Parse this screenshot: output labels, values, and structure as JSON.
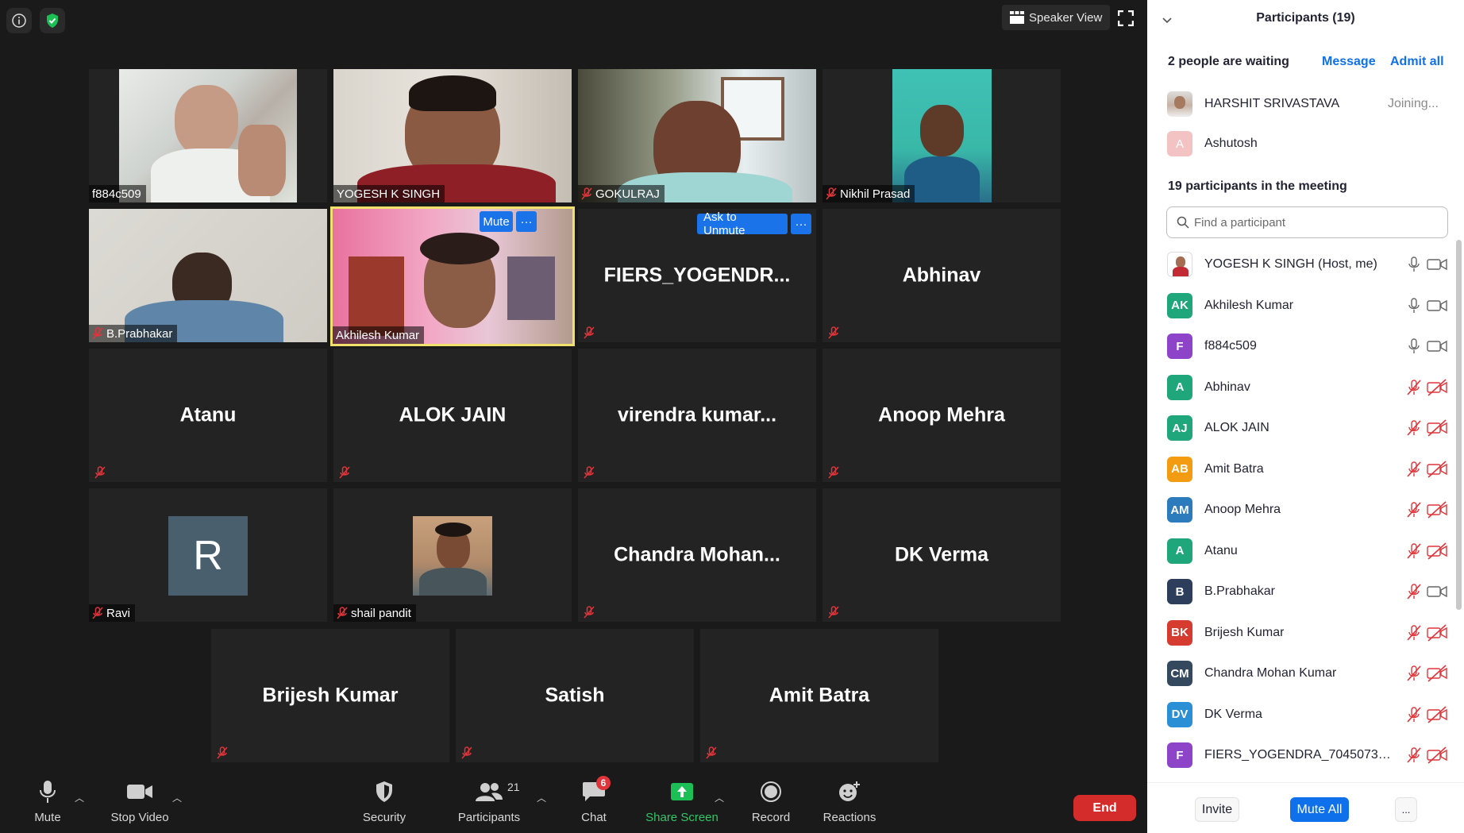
{
  "meeting": {
    "top_bar": {
      "speaker_view_label": "Speaker View"
    },
    "tiles": [
      {
        "name": "f884c509",
        "kind": "video",
        "muted": false
      },
      {
        "name": "YOGESH K SINGH",
        "kind": "video",
        "muted": false
      },
      {
        "name": "GOKULRAJ",
        "kind": "video",
        "muted": true
      },
      {
        "name": "Nikhil Prasad",
        "kind": "video",
        "muted": true
      },
      {
        "name": "B.Prabhakar",
        "kind": "video",
        "muted": true
      },
      {
        "name": "Akhilesh Kumar",
        "kind": "video",
        "muted": false,
        "active_speaker": true,
        "hover_button": "Mute"
      },
      {
        "name": "FIERS_YOGENDR...",
        "kind": "name",
        "muted": true,
        "hover_button": "Ask to Unmute"
      },
      {
        "name": "Abhinav",
        "kind": "name",
        "muted": true
      },
      {
        "name": "Atanu",
        "kind": "name",
        "muted": true
      },
      {
        "name": "ALOK JAIN",
        "kind": "name",
        "muted": true
      },
      {
        "name": "virendra  kumar...",
        "kind": "name",
        "muted": true
      },
      {
        "name": "Anoop Mehra",
        "kind": "name",
        "muted": true
      },
      {
        "name": "Ravi",
        "kind": "avatar",
        "avatar_letter": "R",
        "muted": true
      },
      {
        "name": "shail pandit",
        "kind": "photo",
        "muted": true
      },
      {
        "name": "Chandra  Mohan...",
        "kind": "name",
        "muted": true
      },
      {
        "name": "DK Verma",
        "kind": "name",
        "muted": true
      },
      {
        "name": "Brijesh Kumar",
        "kind": "name",
        "muted": true
      },
      {
        "name": "Satish",
        "kind": "name",
        "muted": true
      },
      {
        "name": "Amit Batra",
        "kind": "name",
        "muted": true
      }
    ],
    "more_label": "···"
  },
  "toolbar": {
    "mute_label": "Mute",
    "stop_video_label": "Stop Video",
    "security_label": "Security",
    "participants_label": "Participants",
    "participants_count": "21",
    "chat_label": "Chat",
    "chat_badge": "6",
    "share_screen_label": "Share Screen",
    "record_label": "Record",
    "reactions_label": "Reactions",
    "end_label": "End"
  },
  "panel": {
    "title": "Participants (19)",
    "waiting_label": "2 people are waiting",
    "message_link": "Message",
    "admit_all_link": "Admit all",
    "waiting": [
      {
        "name": "HARSHIT SRIVASTAVA",
        "status": "Joining..."
      },
      {
        "name": "Ashutosh",
        "status": "",
        "initial": "A"
      }
    ],
    "in_meeting_label": "19 participants in the meeting",
    "search_placeholder": "Find a participant",
    "participants": [
      {
        "initials": "",
        "name": "YOGESH K SINGH (Host, me)",
        "color": "#ffffff",
        "mic_on": true,
        "cam_on": true
      },
      {
        "initials": "AK",
        "name": "Akhilesh Kumar",
        "color": "#1fa67a",
        "mic_on": true,
        "cam_on": true
      },
      {
        "initials": "F",
        "name": "f884c509",
        "color": "#8e44c9",
        "mic_on": true,
        "cam_on": true
      },
      {
        "initials": "A",
        "name": "Abhinav",
        "color": "#1fa67a",
        "mic_on": false,
        "cam_on": false
      },
      {
        "initials": "AJ",
        "name": "ALOK JAIN",
        "color": "#1fa67a",
        "mic_on": false,
        "cam_on": false
      },
      {
        "initials": "AB",
        "name": "Amit Batra",
        "color": "#f39c12",
        "mic_on": false,
        "cam_on": false
      },
      {
        "initials": "AM",
        "name": "Anoop Mehra",
        "color": "#2b7bbd",
        "mic_on": false,
        "cam_on": false
      },
      {
        "initials": "A",
        "name": "Atanu",
        "color": "#1fa67a",
        "mic_on": false,
        "cam_on": false
      },
      {
        "initials": "B",
        "name": "B.Prabhakar",
        "color": "#2c3e5c",
        "mic_on": false,
        "cam_on": true
      },
      {
        "initials": "BK",
        "name": "Brijesh Kumar",
        "color": "#d63b2f",
        "mic_on": false,
        "cam_on": false
      },
      {
        "initials": "CM",
        "name": "Chandra Mohan Kumar",
        "color": "#34495e",
        "mic_on": false,
        "cam_on": false
      },
      {
        "initials": "DV",
        "name": "DK Verma",
        "color": "#2b8fd6",
        "mic_on": false,
        "cam_on": false
      },
      {
        "initials": "F",
        "name": "FIERS_YOGENDRA_7045073598_...",
        "color": "#8e44c9",
        "mic_on": false,
        "cam_on": false
      }
    ],
    "footer": {
      "invite_label": "Invite",
      "mute_all_label": "Mute All",
      "more_label": "..."
    }
  },
  "colors": {
    "accent": "#0e71eb",
    "end_red": "#d42b2b",
    "muted_red": "#e0353a",
    "active_speaker": "#f0e16c"
  }
}
